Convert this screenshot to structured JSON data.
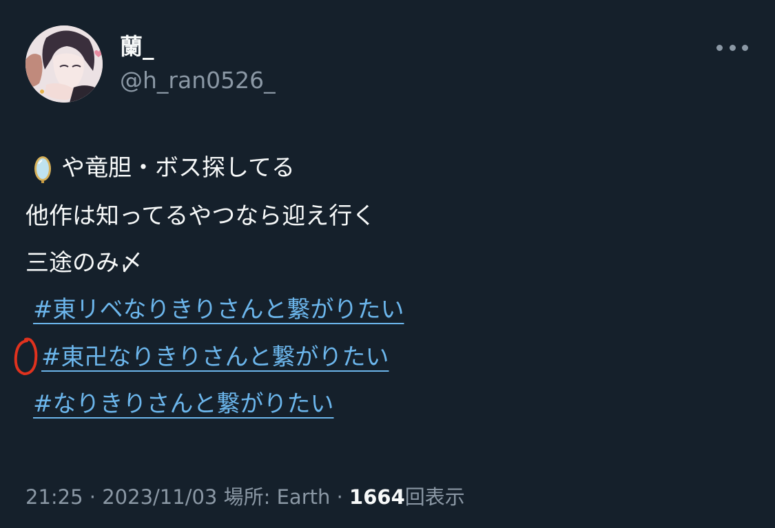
{
  "author": {
    "display_name": "蘭_",
    "handle": "@h_ran0526_"
  },
  "more_icon": "ellipsis-icon",
  "body": {
    "line1_emoji": "mirror-icon",
    "line1_text": "や竜胆・ボス探してる",
    "line2": "他作は知ってるやつなら迎え行く",
    "line3": "三途のみ〆"
  },
  "hashtags": [
    "#東リベなりきりさんと繋がりたい",
    "#東卍なりきりさんと繋がりたい",
    "#なりきりさんと繋がりたい"
  ],
  "annotation": {
    "color": "#e0321e",
    "shape": "red-circle-mark"
  },
  "meta": {
    "time": "21:25",
    "sep1": "·",
    "date": "2023/11/03",
    "location": "場所: Earth",
    "sep2": "·",
    "views_count": "1664",
    "views_label": "回表示"
  },
  "colors": {
    "background": "#15202b",
    "text": "#f7f9f9",
    "muted": "#8b98a5",
    "link": "#6cb6ec"
  }
}
